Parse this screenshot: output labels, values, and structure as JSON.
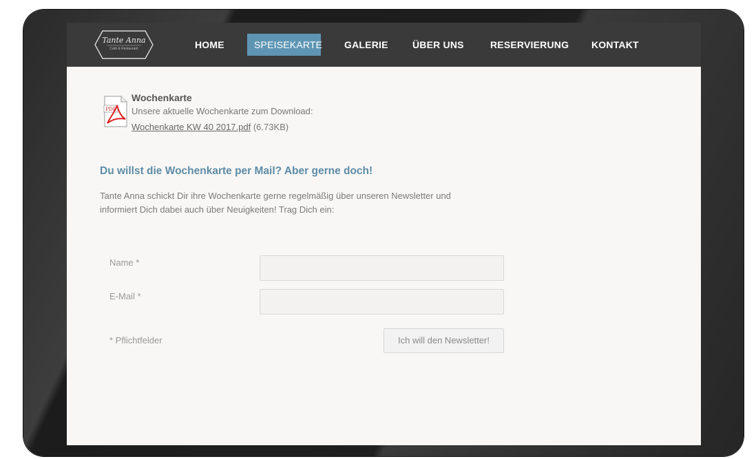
{
  "nav": {
    "logo": {
      "name": "Tante Anna",
      "subtitle": "Café & Restaurant"
    },
    "items": [
      {
        "label": "HOME"
      },
      {
        "label": "SPEISEKARTE"
      },
      {
        "label": "GALERIE"
      },
      {
        "label": "ÜBER UNS"
      },
      {
        "label": "RESERVIERUNG"
      },
      {
        "label": "KONTAKT"
      }
    ],
    "active_item": "SPEISEKARTE"
  },
  "download": {
    "icon": "pdf-file-icon",
    "title": "Wochenkarte",
    "description": "Unsere aktuelle Wochenkarte zum Download:",
    "link_text": "Wochenkarte KW 40 2017.pdf",
    "size": "(6.73KB)"
  },
  "newsletter": {
    "heading": "Du willst die Wochenkarte per Mail? Aber gerne doch!",
    "text_line1": "Tante Anna schickt Dir ihre Wochenkarte gerne regelmäßig über unseren Newsletter und",
    "text_line2": "informiert Dich dabei auch über Neuigkeiten! Trag Dich ein:",
    "fields": {
      "name_label": "Name *",
      "name_value": "",
      "email_label": "E-Mail *",
      "email_value": ""
    },
    "required_note": "* Pflichtfelder",
    "submit_label": "Ich will den Newsletter!"
  },
  "colors": {
    "nav_bg": "#3a3a3a",
    "active_bg": "#5e95b3",
    "heading": "#5e8ca6",
    "page_bg": "#f8f7f5"
  }
}
